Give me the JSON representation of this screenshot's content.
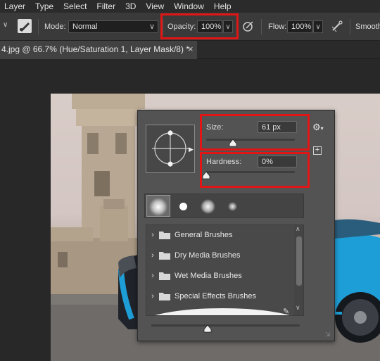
{
  "menu": [
    "Layer",
    "Type",
    "Select",
    "Filter",
    "3D",
    "View",
    "Window",
    "Help"
  ],
  "options_bar": {
    "mode_label": "Mode:",
    "mode_value": "Normal",
    "opacity_label": "Opacity:",
    "opacity_value": "100%",
    "flow_label": "Flow:",
    "flow_value": "100%",
    "smooth_label": "Smooth"
  },
  "document_tab": {
    "title": "4.jpg @ 66.7% (Hue/Saturation 1, Layer Mask/8) *",
    "close": "×"
  },
  "brush_popup": {
    "size_label": "Size:",
    "size_value": "61 px",
    "hardness_label": "Hardness:",
    "hardness_value": "0%",
    "size_fraction": 0.3,
    "hardness_fraction": 0.0,
    "folders": [
      {
        "label": "General Brushes"
      },
      {
        "label": "Dry Media Brushes"
      },
      {
        "label": "Wet Media Brushes"
      },
      {
        "label": "Special Effects Brushes"
      }
    ]
  },
  "colors": {
    "highlight": "#e01515",
    "panel": "#535353",
    "car_blue": "#1e9ed6"
  }
}
